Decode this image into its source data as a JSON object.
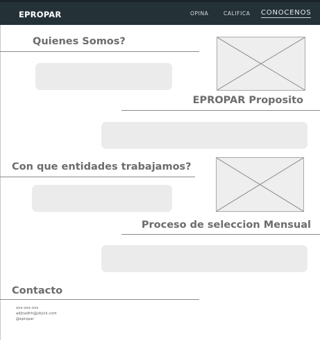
{
  "nav": {
    "brand": "EPROPAR",
    "links": [
      "OPINA",
      "CALIFICA",
      "CONOCENOS"
    ]
  },
  "sections": {
    "quienes": "Quienes Somos?",
    "proposito": "EPROPAR Proposito",
    "entidades": "Con que entidades trabajamos?",
    "proceso": "Proceso de seleccion Mensual",
    "contacto": "Contacto"
  },
  "contact": {
    "phone": "xxx-xxx-xxx",
    "email": "adjhadhh@jdcjck.com",
    "handle": "@epropar"
  },
  "colors": {
    "navbar": "#243238",
    "panel": "#ebebeb",
    "heading": "#6c6c6c"
  },
  "icons": {
    "image_placeholder": "image-placeholder-icon"
  }
}
